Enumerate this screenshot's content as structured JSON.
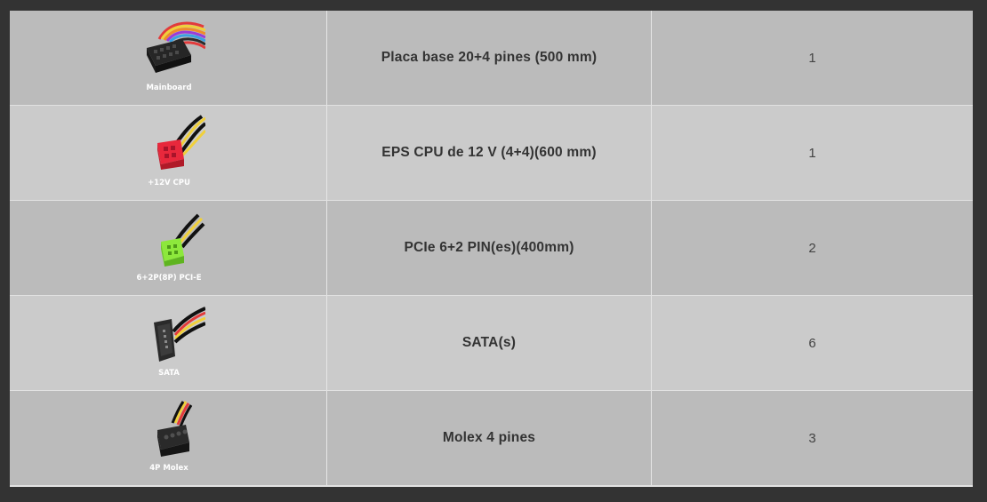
{
  "rows": [
    {
      "caption": "Mainboard",
      "name": "Placa base 20+4 pines (500 mm)",
      "qty": "1",
      "icon": "mainboard-connector-icon"
    },
    {
      "caption": "+12V CPU",
      "name": "EPS CPU de 12 V (4+4)(600 mm)",
      "qty": "1",
      "icon": "cpu-connector-icon"
    },
    {
      "caption": "6+2P(8P) PCI-E",
      "name": "PCIe 6+2 PIN(es)(400mm)",
      "qty": "2",
      "icon": "pcie-connector-icon"
    },
    {
      "caption": "SATA",
      "name": "SATA(s)",
      "qty": "6",
      "icon": "sata-connector-icon"
    },
    {
      "caption": "4P Molex",
      "name": "Molex 4 pines",
      "qty": "3",
      "icon": "molex-connector-icon"
    }
  ],
  "colors": {
    "page_background": "#333333",
    "row_dark": "#bbbbbb",
    "row_light": "#cbcbcb",
    "cpu_connector": "#e8283c",
    "pcie_connector": "#8de83c"
  }
}
